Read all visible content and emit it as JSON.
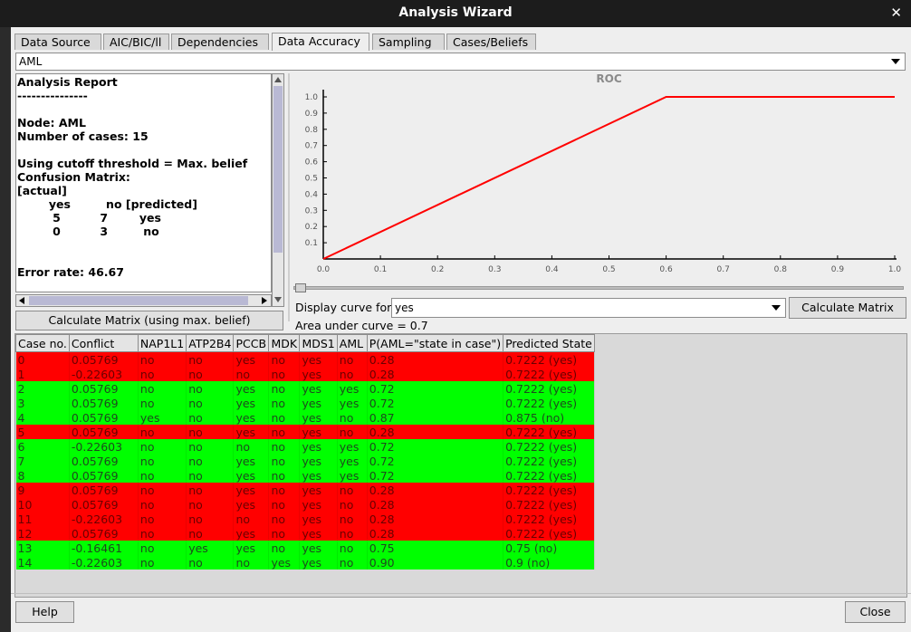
{
  "window": {
    "title": "Analysis Wizard",
    "close_glyph": "✕"
  },
  "tabs": [
    "Data Source",
    "AIC/BIC/ll",
    "Dependencies",
    "Data Accuracy",
    "Sampling",
    "Cases/Beliefs"
  ],
  "active_tab": "Data Accuracy",
  "node_select": {
    "value": "AML"
  },
  "report": {
    "text": "Analysis Report\n---------------\n\nNode: AML\nNumber of cases: 15\n\nUsing cutoff threshold = Max. belief\nConfusion Matrix:\n[actual]\n        yes         no [predicted]\n         5          7        yes\n         0          3         no\n\n\nError rate: 46.67"
  },
  "calc_max_button": "Calculate Matrix (using max. belief)",
  "chart_data": {
    "type": "line",
    "title": "ROC",
    "series": [
      {
        "x": [
          0.0,
          0.6,
          1.0
        ],
        "y": [
          0.0,
          1.0,
          1.0
        ]
      }
    ],
    "xlim": [
      0,
      1
    ],
    "ylim": [
      0,
      1
    ],
    "xticks": [
      "0.0",
      "0.1",
      "0.2",
      "0.3",
      "0.4",
      "0.5",
      "0.6",
      "0.7",
      "0.8",
      "0.9",
      "1.0"
    ],
    "yticks": [
      "0.1",
      "0.2",
      "0.3",
      "0.4",
      "0.5",
      "0.6",
      "0.7",
      "0.8",
      "0.9",
      "1.0"
    ],
    "line_color": "#ff0000"
  },
  "display_curve": {
    "label": "Display curve for:",
    "value": "yes"
  },
  "calc_matrix_button": "Calculate Matrix",
  "auc_text": "Area under curve = 0.7",
  "table": {
    "columns": [
      "Case no.",
      "Conflict",
      "NAP1L1",
      "ATP2B4",
      "PCCB",
      "MDK",
      "MDS1",
      "AML",
      "P(AML=\"state in case\")",
      "Predicted State"
    ],
    "rows": [
      {
        "status": "wrong",
        "cells": [
          "0",
          "0.05769",
          "no",
          "no",
          "yes",
          "no",
          "yes",
          "no",
          "0.28",
          "0.7222 (yes)"
        ]
      },
      {
        "status": "wrong",
        "cells": [
          "1",
          "-0.22603",
          "no",
          "no",
          "no",
          "no",
          "yes",
          "no",
          "0.28",
          "0.7222 (yes)"
        ]
      },
      {
        "status": "right",
        "cells": [
          "2",
          "0.05769",
          "no",
          "no",
          "yes",
          "no",
          "yes",
          "yes",
          "0.72",
          "0.7222 (yes)"
        ]
      },
      {
        "status": "right",
        "cells": [
          "3",
          "0.05769",
          "no",
          "no",
          "yes",
          "no",
          "yes",
          "yes",
          "0.72",
          "0.7222 (yes)"
        ]
      },
      {
        "status": "right",
        "cells": [
          "4",
          "0.05769",
          "yes",
          "no",
          "yes",
          "no",
          "yes",
          "no",
          "0.87",
          "0.875 (no)"
        ]
      },
      {
        "status": "wrong",
        "cells": [
          "5",
          "0.05769",
          "no",
          "no",
          "yes",
          "no",
          "yes",
          "no",
          "0.28",
          "0.7222 (yes)"
        ]
      },
      {
        "status": "right",
        "cells": [
          "6",
          "-0.22603",
          "no",
          "no",
          "no",
          "no",
          "yes",
          "yes",
          "0.72",
          "0.7222 (yes)"
        ]
      },
      {
        "status": "right",
        "cells": [
          "7",
          "0.05769",
          "no",
          "no",
          "yes",
          "no",
          "yes",
          "yes",
          "0.72",
          "0.7222 (yes)"
        ]
      },
      {
        "status": "right",
        "cells": [
          "8",
          "0.05769",
          "no",
          "no",
          "yes",
          "no",
          "yes",
          "yes",
          "0.72",
          "0.7222 (yes)"
        ]
      },
      {
        "status": "wrong",
        "cells": [
          "9",
          "0.05769",
          "no",
          "no",
          "yes",
          "no",
          "yes",
          "no",
          "0.28",
          "0.7222 (yes)"
        ]
      },
      {
        "status": "wrong",
        "cells": [
          "10",
          "0.05769",
          "no",
          "no",
          "yes",
          "no",
          "yes",
          "no",
          "0.28",
          "0.7222 (yes)"
        ]
      },
      {
        "status": "wrong",
        "cells": [
          "11",
          "-0.22603",
          "no",
          "no",
          "no",
          "no",
          "yes",
          "no",
          "0.28",
          "0.7222 (yes)"
        ]
      },
      {
        "status": "wrong",
        "cells": [
          "12",
          "0.05769",
          "no",
          "no",
          "yes",
          "no",
          "yes",
          "no",
          "0.28",
          "0.7222 (yes)"
        ]
      },
      {
        "status": "right",
        "cells": [
          "13",
          "-0.16461",
          "no",
          "yes",
          "yes",
          "no",
          "yes",
          "no",
          "0.75",
          "0.75 (no)"
        ]
      },
      {
        "status": "right",
        "cells": [
          "14",
          "-0.22603",
          "no",
          "no",
          "no",
          "yes",
          "yes",
          "no",
          "0.90",
          "0.9 (no)"
        ]
      }
    ]
  },
  "buttons": {
    "help": "Help",
    "close": "Close"
  }
}
